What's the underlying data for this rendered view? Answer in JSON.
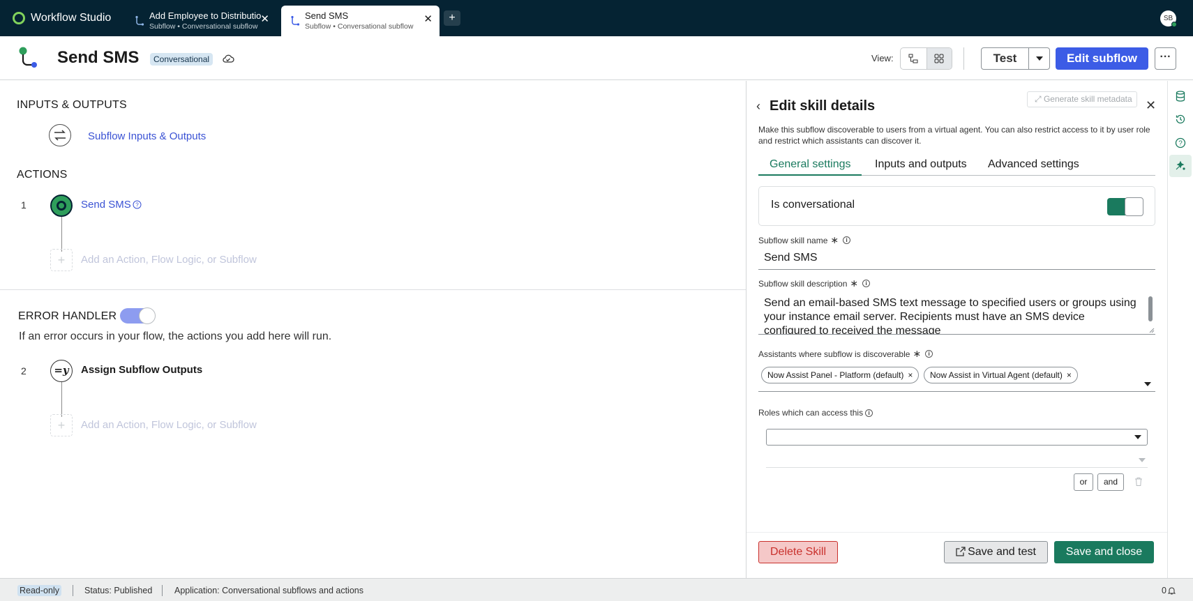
{
  "app": {
    "title": "Workflow Studio",
    "avatar_initials": "SB"
  },
  "tabs": [
    {
      "title": "Add Employee to Distributio",
      "subtitle": "Subflow • Conversational subflow"
    },
    {
      "title": "Send SMS",
      "subtitle": "Subflow • Conversational subflow"
    }
  ],
  "new_tab_label": "+",
  "header": {
    "title": "Send SMS",
    "badge": "Conversational",
    "view_label": "View:",
    "test_label": "Test",
    "edit_label": "Edit subflow",
    "more_label": "···"
  },
  "canvas": {
    "inputs_heading": "INPUTS & OUTPUTS",
    "inputs_link": "Subflow Inputs & Outputs",
    "actions_heading": "ACTIONS",
    "step1_num": "1",
    "step1_label": "Send SMS",
    "add_label": "Add an Action, Flow Logic, or Subflow",
    "add_icon": "+",
    "error_heading": "ERROR HANDLER",
    "error_desc": "If an error occurs in your flow, the actions you add here will run.",
    "step2_num": "2",
    "step2_icon": "=y",
    "step2_label": "Assign Subflow Outputs"
  },
  "panel": {
    "title": "Edit skill details",
    "generate_label": "Generate skill metadata",
    "intro": "Make this subflow discoverable to users from a virtual agent. You can also restrict access to it by user role and restrict which assistants can discover it.",
    "tabs": [
      "General settings",
      "Inputs and outputs",
      "Advanced settings"
    ],
    "is_conversational_label": "Is conversational",
    "is_conversational": true,
    "skill_name_label": "Subflow skill name",
    "skill_name": "Send SMS",
    "skill_desc_label": "Subflow skill description",
    "skill_desc": "Send an email-based SMS text message to specified users or groups using your instance email server. Recipients must have an SMS device configured to received the message",
    "assistants_label": "Assistants where subflow is discoverable",
    "assistants": [
      "Now Assist Panel - Platform (default)",
      "Now Assist in Virtual Agent (default)"
    ],
    "roles_label": "Roles which can access this",
    "or_label": "or",
    "and_label": "and",
    "delete_label": "Delete Skill",
    "save_test_label": "Save and test",
    "save_close_label": "Save and close",
    "required_mark": "∗",
    "info_mark": "i",
    "remove_mark": "×"
  },
  "statusbar": {
    "mode": "Read-only",
    "status": "Status: Published",
    "application": "Application: Conversational subflows and actions",
    "notifications": "0"
  },
  "colors": {
    "appbar": "#052333",
    "accent_blue": "#3c5ce6",
    "accent_green": "#1a7a5e",
    "danger": "#c9302c",
    "brand_logo": "#81d25c"
  }
}
